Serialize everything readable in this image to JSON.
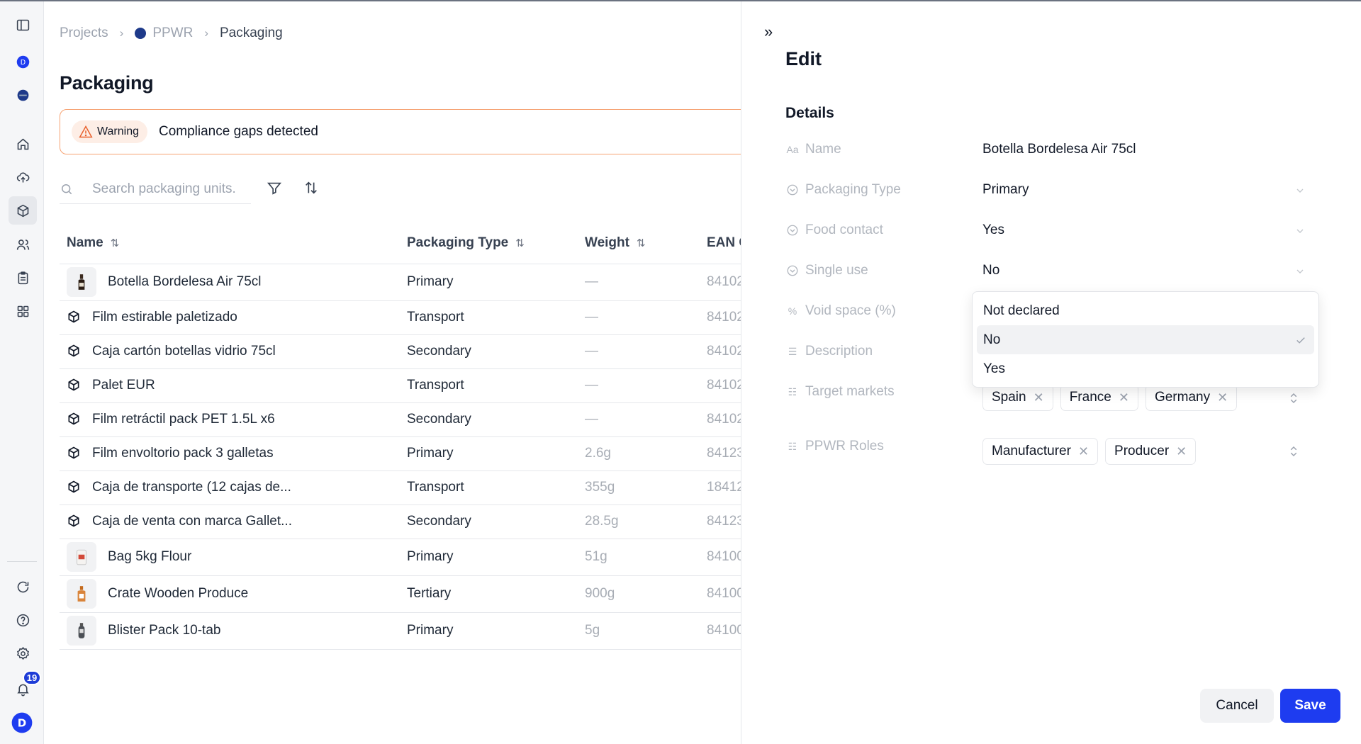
{
  "breadcrumb": {
    "projects": "Projects",
    "project": "PPWR",
    "current": "Packaging"
  },
  "page_title": "Packaging",
  "warning": {
    "label": "Warning",
    "text": "Compliance gaps detected"
  },
  "search": {
    "placeholder": "Search packaging units."
  },
  "table": {
    "columns": [
      "Name",
      "Packaging Type",
      "Weight",
      "EAN C"
    ],
    "rows": [
      {
        "name": "Botella Bordelesa Air 75cl",
        "type": "Primary",
        "weight": "—",
        "ean": "84102",
        "thumb": "bottle"
      },
      {
        "name": "Film estirable paletizado",
        "type": "Transport",
        "weight": "—",
        "ean": "84102",
        "thumb": "box-icon"
      },
      {
        "name": "Caja cartón botellas vidrio 75cl",
        "type": "Secondary",
        "weight": "—",
        "ean": "84102",
        "thumb": "box-icon"
      },
      {
        "name": "Palet EUR",
        "type": "Transport",
        "weight": "—",
        "ean": "84102",
        "thumb": "box-icon"
      },
      {
        "name": "Film retráctil pack PET 1.5L x6",
        "type": "Secondary",
        "weight": "—",
        "ean": "84102",
        "thumb": "box-icon"
      },
      {
        "name": "Film envoltorio pack 3 galletas",
        "type": "Primary",
        "weight": "2.6g",
        "ean": "84123",
        "thumb": "box-icon"
      },
      {
        "name": "Caja de transporte (12 cajas de...",
        "type": "Transport",
        "weight": "355g",
        "ean": "18412",
        "thumb": "box-icon"
      },
      {
        "name": "Caja de venta con marca Gallet...",
        "type": "Secondary",
        "weight": "28.5g",
        "ean": "84123",
        "thumb": "box-icon"
      },
      {
        "name": "Bag 5kg Flour",
        "type": "Primary",
        "weight": "51g",
        "ean": "84100",
        "thumb": "bag"
      },
      {
        "name": "Crate Wooden Produce",
        "type": "Tertiary",
        "weight": "900g",
        "ean": "84100",
        "thumb": "jar"
      },
      {
        "name": "Blister Pack 10-tab",
        "type": "Primary",
        "weight": "5g",
        "ean": "84100",
        "thumb": "flask"
      }
    ]
  },
  "sidebar": {
    "notifications_count": "19"
  },
  "edit": {
    "title": "Edit",
    "section": "Details",
    "fields": {
      "name": {
        "label": "Name",
        "value": "Botella Bordelesa Air 75cl"
      },
      "packaging_type": {
        "label": "Packaging Type",
        "value": "Primary"
      },
      "food_contact": {
        "label": "Food contact",
        "value": "Yes"
      },
      "single_use": {
        "label": "Single use",
        "value": "No"
      },
      "void_space": {
        "label": "Void space (%)"
      },
      "description": {
        "label": "Description"
      },
      "target_markets": {
        "label": "Target markets",
        "tags": [
          "Spain",
          "France",
          "Germany"
        ]
      },
      "ppwr_roles": {
        "label": "PPWR Roles",
        "tags": [
          "Manufacturer",
          "Producer"
        ]
      }
    },
    "dropdown_options": [
      "Not declared",
      "No",
      "Yes"
    ],
    "dropdown_selected": "No",
    "cancel": "Cancel",
    "save": "Save"
  },
  "colors": {
    "primary": "#1e3cf0",
    "warning_border": "#f6a272",
    "warning_bg": "#fdeee6"
  }
}
